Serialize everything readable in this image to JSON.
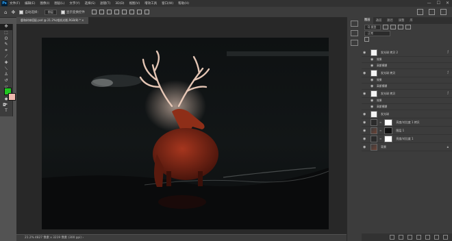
{
  "app": {
    "logo": "Ps"
  },
  "menubar": [
    "文件(F)",
    "编辑(E)",
    "图像(I)",
    "图层(L)",
    "文字(Y)",
    "选择(S)",
    "滤镜(T)",
    "3D(D)",
    "视图(V)",
    "增效工具",
    "窗口(W)",
    "帮助(H)"
  ],
  "window_controls": [
    "—",
    "☐",
    "✕"
  ],
  "options": {
    "auto_select_label": "自动选择：",
    "auto_select_target": "图层",
    "show_transform": "显示变换控件"
  },
  "document_tab": "鹿和树林搭配.psd @ 21.2%(相机光影,RGB/8) *  ×",
  "status": "21.2%      4827 像素 x 3219 像素 (300 ppi)     ›",
  "layers_panel": {
    "tabs": [
      "图层",
      "通道",
      "路径",
      "调整",
      "库"
    ],
    "kind_filter": "Q 类型",
    "blend_mode": "正常"
  },
  "layers": [
    {
      "type": "layer",
      "name": "发光球 拷贝 2",
      "thumb": "white",
      "fx": true
    },
    {
      "type": "sub",
      "name": "效果"
    },
    {
      "type": "sub",
      "name": "高斯模糊"
    },
    {
      "type": "layer",
      "name": "发光球 拷贝",
      "thumb": "white",
      "fx": true
    },
    {
      "type": "sub",
      "name": "效果"
    },
    {
      "type": "sub",
      "name": "高斯模糊"
    },
    {
      "type": "layer",
      "name": "发光球 拷贝",
      "thumb": "white",
      "fx": true
    },
    {
      "type": "sub",
      "name": "效果"
    },
    {
      "type": "sub",
      "name": "高斯模糊"
    },
    {
      "type": "layer",
      "name": "发光球",
      "thumb": "white",
      "fx": false
    },
    {
      "type": "adj",
      "name": "亮度/对比度 1 拷贝",
      "thumb": "dark",
      "mask": "white"
    },
    {
      "type": "adj",
      "name": "图层 1",
      "thumb": "photo",
      "mask": "black"
    },
    {
      "type": "adj",
      "name": "亮度/对比度 1",
      "thumb": "dark",
      "mask": "white"
    },
    {
      "type": "layer",
      "name": "背景",
      "thumb": "photo",
      "fx": false
    }
  ],
  "colors": {
    "foreground": "#21c521",
    "background": "#f0b8ae"
  }
}
